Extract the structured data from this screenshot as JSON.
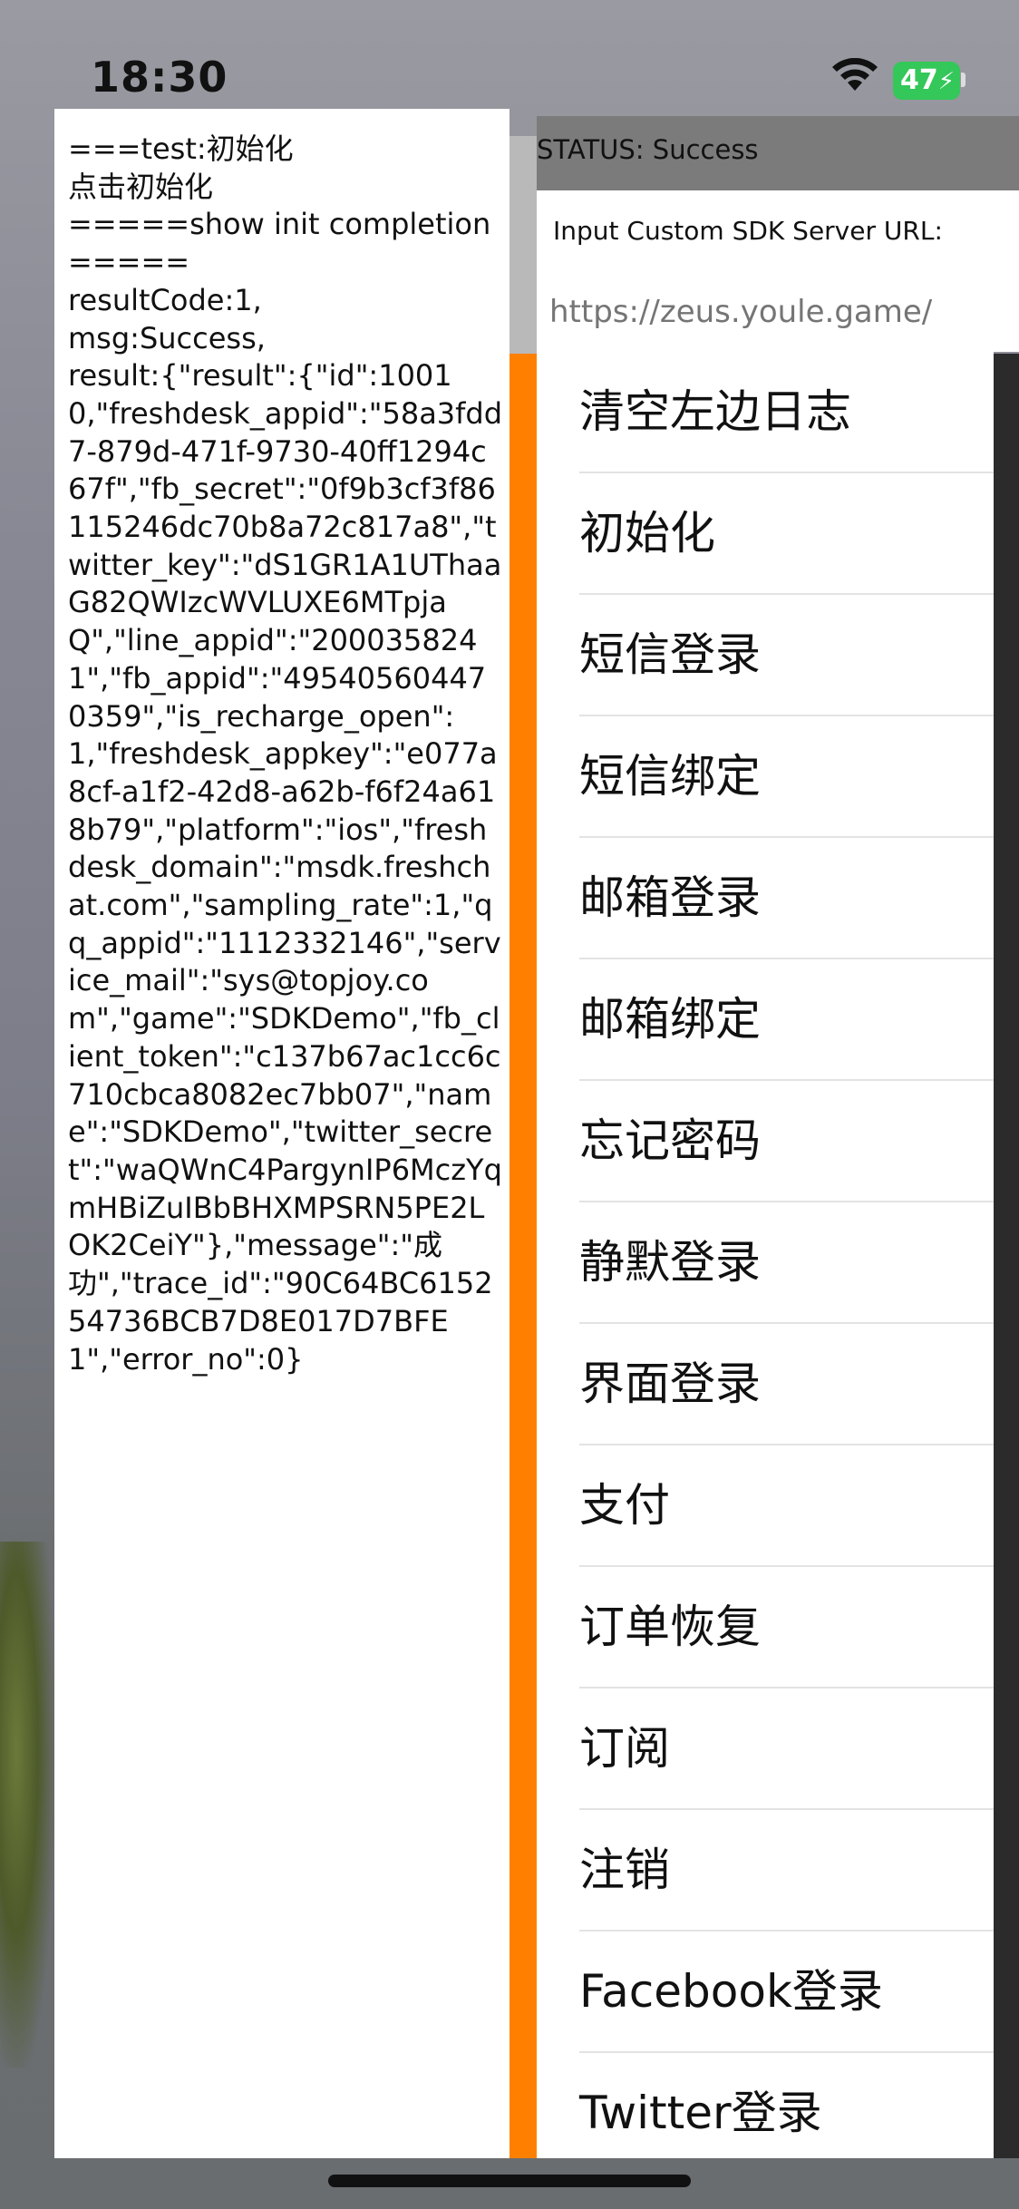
{
  "status_bar": {
    "time": "18:30",
    "battery": "47"
  },
  "log": {
    "text": "===test:初始化\n点击初始化\n=====show init completion=====\nresultCode:1,\nmsg:Success,\nresult:{\"result\":{\"id\":10010,\"freshdesk_appid\":\"58a3fdd7-879d-471f-9730-40ff1294c67f\",\"fb_secret\":\"0f9b3cf3f86115246dc70b8a72c817a8\",\"twitter_key\":\"dS1GR1A1UThaaG82QWIzcWVLUXE6MTpjaQ\",\"line_appid\":\"2000358241\",\"fb_appid\":\"495405604470359\",\"is_recharge_open\":1,\"freshdesk_appkey\":\"e077a8cf-a1f2-42d8-a62b-f6f24a618b79\",\"platform\":\"ios\",\"freshdesk_domain\":\"msdk.freshchat.com\",\"sampling_rate\":1,\"qq_appid\":\"1112332146\",\"service_mail\":\"sys@topjoy.com\",\"game\":\"SDKDemo\",\"fb_client_token\":\"c137b67ac1cc6c710cbca8082ec7bb07\",\"name\":\"SDKDemo\",\"twitter_secret\":\"waQWnC4PargynIP6MczYqmHBiZuIBbBHXMPSRN5PE2LOK2CeiY\"},\"message\":\"成功\",\"trace_id\":\"90C64BC615254736BCB7D8E017D7BFE1\",\"error_no\":0}"
  },
  "status": {
    "text": "STATUS: Success"
  },
  "server": {
    "label": "Input Custom SDK Server URL:",
    "placeholder": "https://zeus.youle.game/"
  },
  "menu": {
    "items": [
      {
        "label": "清空左边日志"
      },
      {
        "label": "初始化"
      },
      {
        "label": "短信登录"
      },
      {
        "label": "短信绑定"
      },
      {
        "label": "邮箱登录"
      },
      {
        "label": "邮箱绑定"
      },
      {
        "label": "忘记密码"
      },
      {
        "label": "静默登录"
      },
      {
        "label": "界面登录"
      },
      {
        "label": "支付"
      },
      {
        "label": "订单恢复"
      },
      {
        "label": "订阅"
      },
      {
        "label": "注销"
      },
      {
        "label": "Facebook登录"
      },
      {
        "label": "Twitter登录"
      }
    ]
  }
}
